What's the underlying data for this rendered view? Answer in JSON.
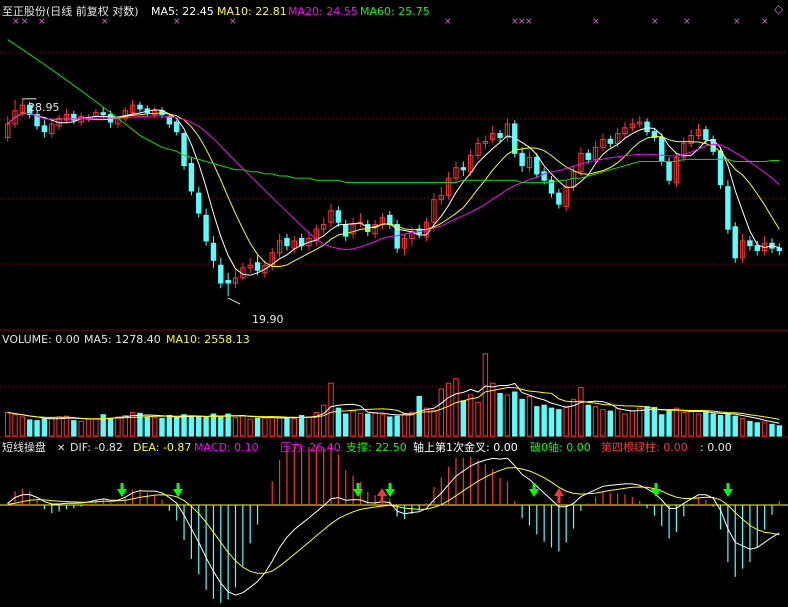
{
  "colors": {
    "background": "#000000",
    "up": "#ff3232",
    "down": "#54ffff",
    "ma5": "#ffffff",
    "ma10": "#ffff00",
    "ma20": "#ff00ff",
    "ma60": "#00e600",
    "grid": "#8b0000",
    "label": "#e6e6e6",
    "dif": "#ffffff",
    "dea": "#ffff00",
    "pressure": "#ff00ff",
    "support": "#00ff00",
    "golden": "#ffffff",
    "break0": "#00ff00",
    "fourth": "#ff3232"
  },
  "header": {
    "title": "至正股份(日线 前复权 对数)",
    "ma5": "MA5: 22.45",
    "ma10": "MA10: 22.81",
    "ma20": "MA20: 24.55",
    "ma60": "MA60: 25.75"
  },
  "volume_header": {
    "label": "VOLUME: 0.00",
    "ma5": "MA5: 1278.40",
    "ma10": "MA10: 2558.13"
  },
  "macd_header": {
    "name": "短线操盘",
    "dif": "DIF: -0.82",
    "dea": "DEA: -0.87",
    "macd": "MACD: 0.10",
    "pressure": "压力: 26.40",
    "support": "支撑: 22.50",
    "golden": "轴上第1次金叉: 0.00",
    "break0": "破0轴: 0.00",
    "fourth": "第四根绿柱: 0.00",
    "extra": ": 0.00"
  },
  "annotations": {
    "high_label": "28.95",
    "low_label": "19.90"
  },
  "chart_data": {
    "type": "candlestick",
    "scale": "log",
    "title": "至正股份(日线 前复权 对数)",
    "price_range": [
      18.8,
      33.5
    ],
    "highest": 28.95,
    "lowest": 19.9,
    "last_ma": {
      "ma5": 22.45,
      "ma10": 22.81,
      "ma20": 24.55,
      "ma60": 25.75
    },
    "closes": [
      27.6,
      28.3,
      28.6,
      28.1,
      27.5,
      27.2,
      27.6,
      27.9,
      28.1,
      27.8,
      28.0,
      27.9,
      28.2,
      28.1,
      27.7,
      27.9,
      28.3,
      28.6,
      28.4,
      28.2,
      28.3,
      28.1,
      27.6,
      27.2,
      25.5,
      24.3,
      23.3,
      22.1,
      21.3,
      20.4,
      20.4,
      20.6,
      21.0,
      21.1,
      20.9,
      21.1,
      21.6,
      22.1,
      21.9,
      22.1,
      21.9,
      22.2,
      22.6,
      22.8,
      23.4,
      22.9,
      22.3,
      22.8,
      22.9,
      22.5,
      22.8,
      23.1,
      22.8,
      21.8,
      22.2,
      22.5,
      22.4,
      22.9,
      23.9,
      24.1,
      24.9,
      25.4,
      25.3,
      26.0,
      26.6,
      26.7,
      27.1,
      26.9,
      27.6,
      26.1,
      25.5,
      25.9,
      25.1,
      24.8,
      24.2,
      23.7,
      24.5,
      25.2,
      26.1,
      25.8,
      26.4,
      26.8,
      26.6,
      27.1,
      27.4,
      27.6,
      27.7,
      27.2,
      26.9,
      25.7,
      24.8,
      25.9,
      26.6,
      27.0,
      27.3,
      26.8,
      26.2,
      24.6,
      22.6,
      21.4,
      22.1,
      21.9,
      21.7,
      22.0,
      21.8,
      21.7
    ],
    "opens": [
      26.9,
      27.6,
      28.2,
      28.6,
      28.1,
      27.5,
      27.1,
      27.5,
      27.8,
      28.1,
      27.7,
      27.9,
      28.0,
      28.2,
      28.1,
      27.6,
      27.9,
      28.2,
      28.6,
      28.4,
      28.1,
      28.3,
      28.0,
      27.7,
      27.1,
      25.6,
      24.2,
      23.2,
      22.0,
      21.1,
      20.5,
      20.4,
      20.6,
      21.0,
      21.2,
      20.8,
      21.1,
      21.6,
      22.2,
      21.8,
      22.2,
      21.9,
      22.1,
      22.6,
      22.9,
      23.4,
      22.8,
      22.4,
      22.9,
      22.8,
      22.4,
      22.8,
      23.2,
      22.8,
      21.8,
      22.2,
      22.6,
      22.3,
      22.9,
      23.9,
      24.1,
      24.9,
      25.4,
      25.2,
      26.0,
      26.6,
      26.8,
      27.1,
      26.9,
      27.6,
      26.1,
      25.4,
      25.9,
      25.2,
      24.8,
      24.2,
      23.6,
      24.5,
      25.2,
      26.1,
      25.8,
      26.4,
      26.8,
      26.6,
      27.1,
      27.4,
      27.6,
      27.7,
      27.2,
      26.9,
      25.7,
      24.7,
      25.9,
      26.6,
      27.0,
      27.3,
      26.8,
      26.2,
      24.5,
      22.7,
      21.4,
      22.1,
      21.9,
      21.7,
      22.0,
      21.8
    ],
    "highs": [
      28.0,
      28.9,
      28.95,
      28.8,
      28.3,
      27.8,
      27.8,
      28.1,
      28.4,
      28.3,
      28.2,
      28.1,
      28.4,
      28.5,
      28.3,
      28.0,
      28.5,
      28.9,
      28.8,
      28.6,
      28.5,
      28.5,
      28.1,
      27.8,
      27.2,
      25.9,
      24.5,
      23.5,
      22.3,
      21.4,
      20.8,
      20.9,
      21.2,
      21.4,
      21.5,
      21.3,
      21.8,
      22.4,
      22.4,
      22.3,
      22.4,
      22.5,
      22.8,
      23.1,
      23.7,
      23.6,
      23.0,
      23.1,
      23.3,
      23.0,
      23.0,
      23.3,
      23.4,
      23.0,
      22.4,
      22.7,
      22.8,
      23.1,
      24.2,
      24.5,
      25.2,
      25.7,
      25.7,
      26.3,
      26.9,
      27.0,
      27.5,
      27.3,
      27.9,
      27.8,
      26.4,
      26.2,
      26.1,
      25.4,
      25.0,
      24.4,
      24.8,
      25.5,
      26.4,
      26.3,
      26.7,
      27.1,
      27.0,
      27.4,
      27.7,
      27.9,
      28.0,
      27.9,
      27.4,
      27.1,
      25.9,
      26.1,
      26.9,
      27.3,
      27.6,
      27.5,
      27.0,
      26.4,
      24.8,
      22.9,
      22.4,
      22.3,
      22.1,
      22.3,
      22.2,
      22.0
    ],
    "lows": [
      26.7,
      27.4,
      28.0,
      27.9,
      27.3,
      26.9,
      26.9,
      27.3,
      27.6,
      27.6,
      27.5,
      27.7,
      27.8,
      27.9,
      27.4,
      27.4,
      27.7,
      28.0,
      28.2,
      28.0,
      27.9,
      27.9,
      27.4,
      27.0,
      25.3,
      24.1,
      23.1,
      21.9,
      21.0,
      20.2,
      19.9,
      20.2,
      20.5,
      20.8,
      20.7,
      20.6,
      20.9,
      21.4,
      21.7,
      21.6,
      21.7,
      21.7,
      21.9,
      22.4,
      22.7,
      22.7,
      22.1,
      22.2,
      22.7,
      22.3,
      22.2,
      22.6,
      22.6,
      21.6,
      21.5,
      21.9,
      22.2,
      22.1,
      22.7,
      23.7,
      23.9,
      24.7,
      25.0,
      25.0,
      25.8,
      26.3,
      26.6,
      26.6,
      26.7,
      25.9,
      25.2,
      25.2,
      24.9,
      24.6,
      24.0,
      23.5,
      23.4,
      24.3,
      25.0,
      25.6,
      25.6,
      26.2,
      26.4,
      26.4,
      26.9,
      27.2,
      27.4,
      27.0,
      26.7,
      25.5,
      24.6,
      24.5,
      25.7,
      26.4,
      26.8,
      26.6,
      26.0,
      24.4,
      22.4,
      21.2,
      21.2,
      21.7,
      21.5,
      21.5,
      21.6,
      21.5
    ],
    "ma60_series": [
      32.4,
      32.1,
      31.8,
      31.5,
      31.2,
      30.9,
      30.6,
      30.3,
      30.0,
      29.7,
      29.4,
      29.1,
      28.8,
      28.5,
      28.2,
      27.9,
      27.6,
      27.3,
      27.0,
      26.8,
      26.6,
      26.4,
      26.3,
      26.2,
      26.0,
      25.9,
      25.8,
      25.7,
      25.6,
      25.5,
      25.4,
      25.3,
      25.3,
      25.2,
      25.2,
      25.1,
      25.1,
      25.0,
      25.0,
      24.9,
      24.9,
      24.9,
      24.8,
      24.8,
      24.8,
      24.8,
      24.7,
      24.7,
      24.7,
      24.7,
      24.7,
      24.7,
      24.7,
      24.7,
      24.7,
      24.7,
      24.7,
      24.7,
      24.7,
      24.7,
      24.7,
      24.7,
      24.8,
      24.8,
      24.8,
      24.8,
      24.8,
      24.8,
      24.8,
      24.8,
      24.7,
      24.7,
      24.7,
      24.7,
      24.7,
      24.8,
      24.8,
      24.9,
      24.9,
      25.0,
      25.1,
      25.2,
      25.3,
      25.4,
      25.5,
      25.6,
      25.7,
      25.7,
      25.7,
      25.7,
      25.7,
      25.7,
      25.8,
      25.8,
      25.8,
      25.8,
      25.8,
      25.8,
      25.8,
      25.7,
      25.7,
      25.7,
      25.7,
      25.7,
      25.75,
      25.75
    ],
    "volumes": [
      1600,
      1450,
      1300,
      1100,
      1050,
      1150,
      1250,
      1300,
      1350,
      1050,
      1000,
      1150,
      1200,
      1450,
      1200,
      1300,
      1400,
      1600,
      1550,
      1300,
      1250,
      1200,
      1400,
      1250,
      1450,
      1350,
      1300,
      1300,
      1500,
      1350,
      1500,
      1250,
      1400,
      1150,
      1200,
      1250,
      1300,
      1250,
      1250,
      1200,
      1400,
      1300,
      1600,
      2100,
      3600,
      1900,
      1500,
      1700,
      1550,
      1500,
      1600,
      1450,
      1300,
      1350,
      1500,
      1600,
      2700,
      1900,
      1750,
      3200,
      3600,
      3900,
      2400,
      2800,
      2300,
      5600,
      3600,
      2900,
      2800,
      3000,
      2500,
      2700,
      2000,
      2100,
      1900,
      1800,
      2000,
      2500,
      3300,
      2100,
      2000,
      1800,
      1700,
      1850,
      1500,
      1700,
      1900,
      2000,
      1950,
      1450,
      1700,
      1900,
      1600,
      1700,
      1500,
      1650,
      1500,
      1400,
      1550,
      1350,
      1200,
      1000,
      900,
      950,
      800,
      700
    ],
    "volume_ma5": 1278.4,
    "volume_ma10": 2558.13,
    "macd": {
      "dif": -0.82,
      "dea": -0.87,
      "macd": 0.1,
      "pressure": 26.4,
      "support": 22.5,
      "dif_series": [
        0.05,
        0.22,
        0.3,
        0.31,
        0.22,
        0.1,
        0.03,
        0.03,
        0.05,
        0.05,
        0.06,
        0.09,
        0.14,
        0.18,
        0.14,
        0.14,
        0.23,
        0.36,
        0.42,
        0.41,
        0.41,
        0.36,
        0.22,
        0.05,
        -0.3,
        -0.7,
        -1.1,
        -1.55,
        -1.95,
        -2.3,
        -2.55,
        -2.65,
        -2.58,
        -2.42,
        -2.25,
        -2.0,
        -1.65,
        -1.25,
        -0.95,
        -0.72,
        -0.55,
        -0.38,
        -0.2,
        -0.02,
        0.18,
        0.22,
        0.14,
        0.16,
        0.15,
        0.07,
        0.06,
        0.1,
        0.07,
        -0.18,
        -0.26,
        -0.22,
        -0.2,
        -0.1,
        0.15,
        0.35,
        0.6,
        0.85,
        1.0,
        1.15,
        1.25,
        1.32,
        1.37,
        1.35,
        1.38,
        1.15,
        0.9,
        0.75,
        0.55,
        0.35,
        0.15,
        -0.05,
        -0.05,
        0.05,
        0.25,
        0.35,
        0.45,
        0.55,
        0.58,
        0.6,
        0.62,
        0.62,
        0.58,
        0.48,
        0.35,
        0.15,
        -0.1,
        -0.1,
        0.05,
        0.18,
        0.3,
        0.3,
        0.2,
        -0.15,
        -0.7,
        -1.1,
        -1.2,
        -1.3,
        -1.25,
        -1.1,
        -0.95,
        -0.82
      ],
      "dea_series": [
        0.02,
        0.05,
        0.1,
        0.14,
        0.16,
        0.15,
        0.13,
        0.11,
        0.1,
        0.09,
        0.08,
        0.08,
        0.09,
        0.11,
        0.11,
        0.12,
        0.14,
        0.18,
        0.23,
        0.26,
        0.29,
        0.3,
        0.29,
        0.24,
        0.13,
        -0.04,
        -0.25,
        -0.51,
        -0.8,
        -1.1,
        -1.39,
        -1.64,
        -1.83,
        -1.95,
        -2.01,
        -2.01,
        -1.94,
        -1.8,
        -1.63,
        -1.45,
        -1.27,
        -1.09,
        -0.91,
        -0.73,
        -0.55,
        -0.4,
        -0.29,
        -0.2,
        -0.13,
        -0.09,
        -0.06,
        -0.03,
        -0.01,
        -0.04,
        -0.09,
        -0.11,
        -0.13,
        -0.12,
        -0.07,
        0.01,
        0.13,
        0.27,
        0.42,
        0.56,
        0.7,
        0.82,
        0.93,
        1.02,
        1.09,
        1.1,
        1.06,
        1.0,
        0.91,
        0.8,
        0.67,
        0.52,
        0.41,
        0.34,
        0.32,
        0.33,
        0.35,
        0.39,
        0.43,
        0.46,
        0.49,
        0.52,
        0.53,
        0.52,
        0.48,
        0.41,
        0.31,
        0.23,
        0.19,
        0.19,
        0.21,
        0.23,
        0.22,
        0.15,
        0.0,
        -0.22,
        -0.42,
        -0.6,
        -0.73,
        -0.8,
        -0.83,
        -0.87
      ]
    }
  }
}
